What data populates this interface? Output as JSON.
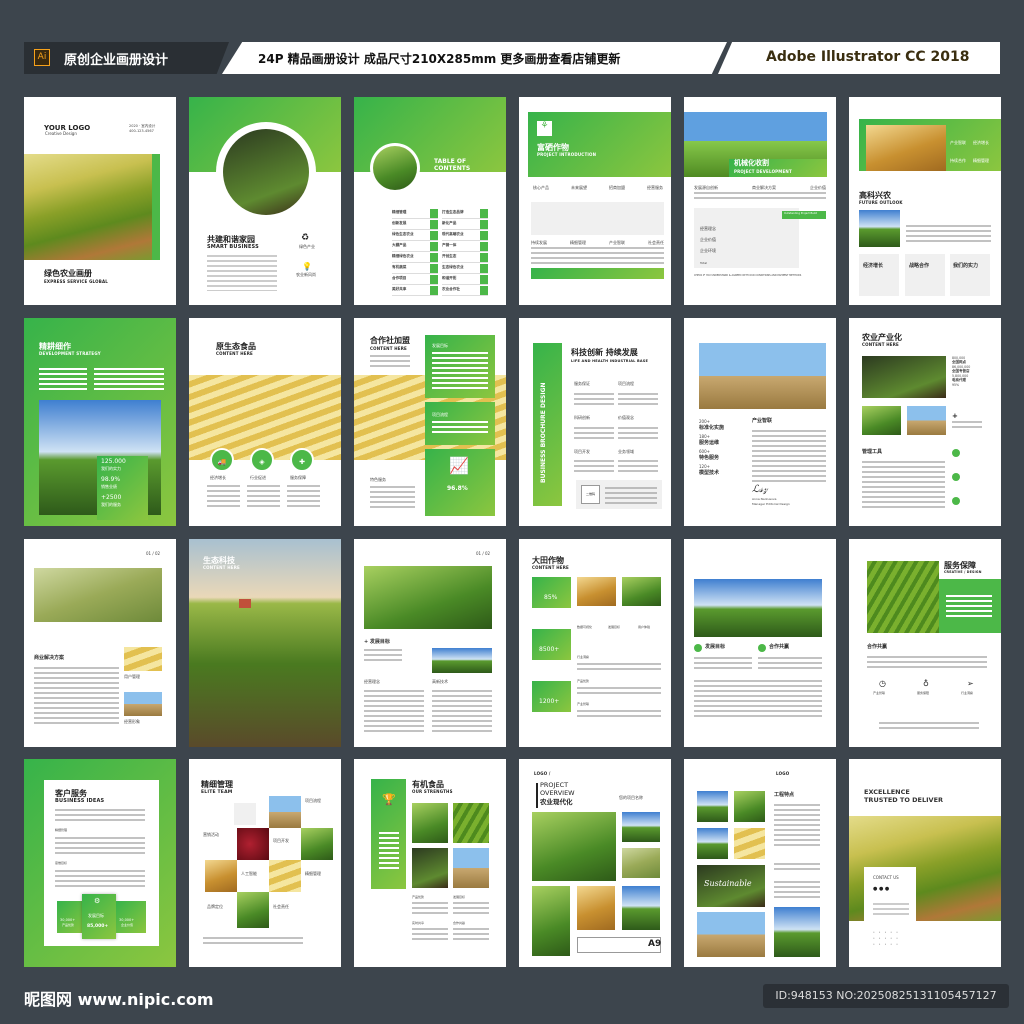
{
  "header": {
    "ai_icon": "Ai",
    "left": "原创企业画册设计",
    "middle": "24P 精品画册设计  成品尺寸210X285mm  更多画册查看店铺更新",
    "right": "Adobe Illustrator CC 2018"
  },
  "footer": {
    "logo": "昵图网 www.nipic.com",
    "id": "ID:948153 NO:20250825131105457127"
  },
  "accent": "#4cb848",
  "pages": {
    "p1": {
      "logo": "YOUR LOGO",
      "logo_sub": "Creative Design",
      "contact1": "2020 · 室内设计",
      "contact2": "400-123-4567",
      "title": "绿色农业画册",
      "subtitle": "EXPRESS SERVICE GLOBAL"
    },
    "p2": {
      "title": "共建和谐家园",
      "subtitle": "SMART BUSINESS",
      "icon1": "绿色产业",
      "icon2": "农业新风尚"
    },
    "p3": {
      "title1": "TABLE OF",
      "title2": "CONTENTS",
      "left": [
        "精细管理",
        "创新发展",
        "绿色生态农业",
        "大棚产品",
        "精细绿色农业",
        "有机蔬菜",
        "合作项目",
        "美好共享"
      ],
      "right": [
        "打造生态品牌",
        "新化产品",
        "现代高端农业",
        "产销一体",
        "开创生态",
        "生态绿色农业",
        "和谐开拓",
        "农业合作社"
      ]
    },
    "p4": {
      "title": "富硒作物",
      "subtitle": "PROJECT INTRODUCTION",
      "tabs": [
        "核心产品",
        "未来展望",
        "招商加盟",
        "经营服务"
      ],
      "labels": [
        "持续发展",
        "精细管理",
        "产业智联",
        "社会责任"
      ]
    },
    "p5": {
      "title": "机械化收割",
      "subtitle": "PROJECT DEVELOPMENT",
      "cols": [
        "发展源自创新",
        "商业解决方案",
        "企业价值"
      ],
      "button": "Outstanding Project Build",
      "rows": [
        "经营理念",
        "企业价值",
        "企业环境"
      ],
      "total": "Total",
      "check": "CHECK IF YOU UNDERSTAND & AGREED WITH OUR CONDITIONS AND PAYMENT METHODS"
    },
    "p6": {
      "grid": [
        "产业智联",
        "经济增长",
        "持续合作",
        "精细管理"
      ],
      "title": "高科兴农",
      "subtitle": "FUTURE OUTLOOK",
      "cards": [
        "经济增长",
        "战略合作",
        "我们的实力"
      ]
    },
    "p7": {
      "title": "精耕细作",
      "subtitle": "DEVELOPMENT STRATEGY",
      "stats": [
        {
          "v": "125.000",
          "l": "我们的实力"
        },
        {
          "v": "98.9%",
          "l": "销售业绩"
        },
        {
          "v": "+2500",
          "l": "我们的服务"
        }
      ]
    },
    "p8": {
      "title": "原生态食品",
      "subtitle": "CONTENT HERE",
      "items": [
        "经济增长",
        "行业促进",
        "服务保障"
      ]
    },
    "p9": {
      "title": "合作社加盟",
      "subtitle": "CONTENT HERE",
      "box1": "发展目标",
      "box2": "项目流程",
      "percent": "96.8%",
      "service": "特色服务"
    },
    "p10": {
      "vertical": "BUSINESS BROCHURE DESIGN",
      "title": "科技创新 持续发展",
      "subtitle": "LIFE AND HEALTH INDUSTRIAL BASE",
      "labels": [
        "服务保证",
        "项目流程",
        "科研创新",
        "价值观念",
        "项目开发",
        "业务领域"
      ],
      "qr": "二维码"
    },
    "p11": {
      "stats": [
        {
          "v": "200+",
          "l": "标准化实施"
        },
        {
          "v": "180+",
          "l": "服务运维"
        },
        {
          "v": "600+",
          "l": "特色服务"
        },
        {
          "v": "120+",
          "l": "模型技术"
        }
      ],
      "heading": "产业智联",
      "sign_name": "Anna Narkusova",
      "sign_role": "Manager Editorial Design"
    },
    "p12": {
      "title": "农业产业化",
      "subtitle": "CONTENT HERE",
      "stats": [
        "800,000",
        "全国网点",
        "86,000,000",
        "全国专营店",
        "5,800,000",
        "电商代理",
        "95%"
      ],
      "tools": "管理工具"
    },
    "p13": {
      "page": "01 / 02",
      "title": "商业解决方案",
      "l1": "用户管理",
      "l2": "经营形象"
    },
    "p14": {
      "title": "生态科技",
      "subtitle": "CONTENT HERE"
    },
    "p15": {
      "page": "01 / 02",
      "goal": "+ 发展目标",
      "l1": "经营理念",
      "l2": "高新技术"
    },
    "p16": {
      "title": "大田作物",
      "subtitle": "CONTENT HERE",
      "stats": [
        "85%",
        "8500+",
        "1200+"
      ],
      "icons": [
        "数据可视化",
        "发展目标",
        "用户体验"
      ],
      "labels": [
        "行业洞察",
        "产品优势",
        "产业智联"
      ]
    },
    "p17": {
      "l1": "发展目标",
      "l2": "合作共赢"
    },
    "p18": {
      "title": "服务保障",
      "subtitle": "CREATIVE / DESIGN",
      "heading": "合作共赢",
      "icons": [
        "产业智联",
        "服务保障",
        "行业洞察"
      ]
    },
    "p19": {
      "title": "客户服务",
      "subtitle": "BUSINESS IDEAS",
      "l1": "精细管理",
      "l2": "思维目标",
      "b1v": "30,000+",
      "b1l": "产品优势",
      "b2l": "发展目标",
      "b2v": "85,000+",
      "b3v": "30,000+",
      "b3l": "企业价值"
    },
    "p20": {
      "title": "精细管理",
      "subtitle": "ELITE TEAM",
      "labels": [
        "项目流程",
        "营销活动",
        "项目开发",
        "人工智能",
        "精细管理",
        "品牌定位",
        "社会责任"
      ]
    },
    "p21": {
      "title": "有机食品",
      "subtitle": "OUR STRENGTHS",
      "labels": [
        "产品优势",
        "发展目标",
        "实时共享",
        "合作共赢"
      ]
    },
    "p22": {
      "logo": "LOGO /",
      "t1": "PROJECT",
      "t2": "OVERVIEW",
      "t3": "农业现代化",
      "name": "您的项目名称",
      "code": "A9"
    },
    "p23": {
      "logo": "LOGO",
      "heading": "工程特点",
      "script": "Sustainable"
    },
    "p24": {
      "t1": "EXCELLENCE",
      "t2": "TRUSTED TO DELIVER",
      "contact": "CONTACT US"
    }
  }
}
